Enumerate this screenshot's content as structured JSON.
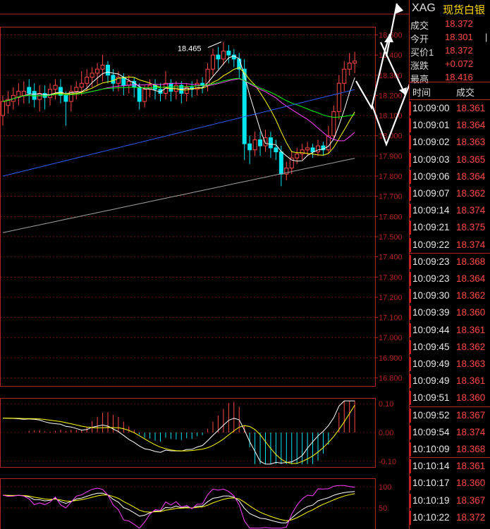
{
  "quote": {
    "symbol": "XAG",
    "name": "现货白银",
    "rows": [
      {
        "label": "成交",
        "value": "18.372",
        "edge": ""
      },
      {
        "label": "今开",
        "value": "18.301",
        "edge": "|"
      },
      {
        "label": "买价1",
        "value": "18.372",
        "edge": ""
      },
      {
        "label": "涨跌",
        "value": "+0.072",
        "edge": ""
      },
      {
        "label": "最高",
        "value": "18.416",
        "edge": ""
      }
    ]
  },
  "ticks": {
    "header_time": "时间",
    "header_price": "成交",
    "rows": [
      {
        "time": "10:09:00",
        "price": "18.361"
      },
      {
        "time": "10:09:01",
        "price": "18.364"
      },
      {
        "time": "10:09:02",
        "price": "18.363"
      },
      {
        "time": "10:09:03",
        "price": "18.365"
      },
      {
        "time": "10:09:06",
        "price": "18.364"
      },
      {
        "time": "10:09:07",
        "price": "18.362"
      },
      {
        "time": "10:09:14",
        "price": "18.374"
      },
      {
        "time": "10:09:21",
        "price": "18.375"
      },
      {
        "time": "10:09:22",
        "price": "18.374"
      },
      {
        "time": "10:09:23",
        "price": "18.368"
      },
      {
        "time": "10:09:23",
        "price": "18.364"
      },
      {
        "time": "10:09:30",
        "price": "18.362"
      },
      {
        "time": "10:09:39",
        "price": "18.360"
      },
      {
        "time": "10:09:44",
        "price": "18.361"
      },
      {
        "time": "10:09:45",
        "price": "18.362"
      },
      {
        "time": "10:09:49",
        "price": "18.363"
      },
      {
        "time": "10:09:49",
        "price": "18.361"
      },
      {
        "time": "10:09:51",
        "price": "18.360"
      },
      {
        "time": "10:09:52",
        "price": "18.367"
      },
      {
        "time": "10:09:54",
        "price": "18.374"
      },
      {
        "time": "10:10:09",
        "price": "18.368"
      },
      {
        "time": "10:10:14",
        "price": "18.361"
      },
      {
        "time": "10:10:17",
        "price": "18.360"
      },
      {
        "time": "10:10:19",
        "price": "18.367"
      },
      {
        "time": "10:10:22",
        "price": "18.372"
      }
    ]
  },
  "colors": {
    "up": "#ff4646",
    "down": "#00e5ee",
    "grid": "#b22222",
    "ma_white": "#ffffff",
    "ma_yellow": "#ffff00",
    "ma_magenta": "#ff40ff",
    "ma_green": "#00ff00",
    "ma_blue": "#3060ff",
    "ma_gray": "#a0a0a0"
  },
  "chart_data": {
    "type": "candlestick",
    "price_axis": {
      "ticks": [
        "18.500",
        "18.400",
        "18.300",
        "18.200",
        "18.100",
        "18.000",
        "17.900",
        "17.800",
        "17.700",
        "17.600",
        "17.500",
        "17.400",
        "17.300",
        "17.200",
        "17.100",
        "17.000",
        "16.900",
        "16.800"
      ],
      "range": [
        16.76,
        18.54
      ]
    },
    "high_marker": "18.465",
    "candles": [
      [
        18.1,
        18.17,
        18.05,
        18.2
      ],
      [
        18.15,
        18.18,
        18.11,
        18.22
      ],
      [
        18.17,
        18.2,
        18.13,
        18.24
      ],
      [
        18.19,
        18.22,
        18.15,
        18.26
      ],
      [
        18.2,
        18.22,
        18.16,
        18.27
      ],
      [
        18.24,
        18.21,
        18.16,
        18.28
      ],
      [
        18.22,
        18.18,
        18.14,
        18.26
      ],
      [
        18.18,
        18.21,
        18.12,
        18.25
      ],
      [
        18.21,
        18.19,
        18.13,
        18.25
      ],
      [
        18.19,
        18.23,
        18.15,
        18.26
      ],
      [
        18.23,
        18.25,
        18.18,
        18.28
      ],
      [
        18.24,
        18.2,
        18.16,
        18.28
      ],
      [
        18.2,
        18.17,
        18.05,
        18.22
      ],
      [
        18.17,
        18.22,
        18.12,
        18.25
      ],
      [
        18.22,
        18.24,
        18.18,
        18.27
      ],
      [
        18.24,
        18.26,
        18.2,
        18.32
      ],
      [
        18.26,
        18.29,
        18.22,
        18.33
      ],
      [
        18.29,
        18.31,
        18.24,
        18.34
      ],
      [
        18.31,
        18.33,
        18.25,
        18.36
      ],
      [
        18.33,
        18.35,
        18.27,
        18.4
      ],
      [
        18.35,
        18.3,
        18.26,
        18.37
      ],
      [
        18.3,
        18.26,
        18.22,
        18.33
      ],
      [
        18.26,
        18.29,
        18.22,
        18.32
      ],
      [
        18.29,
        18.25,
        18.2,
        18.31
      ],
      [
        18.25,
        18.27,
        18.21,
        18.3
      ],
      [
        18.27,
        18.24,
        18.19,
        18.29
      ],
      [
        18.24,
        18.17,
        18.13,
        18.26
      ],
      [
        18.17,
        18.23,
        18.14,
        18.25
      ],
      [
        18.23,
        18.25,
        18.19,
        18.28
      ],
      [
        18.25,
        18.23,
        18.18,
        18.28
      ],
      [
        18.23,
        18.21,
        18.17,
        18.26
      ],
      [
        18.21,
        18.26,
        18.18,
        18.32
      ],
      [
        18.26,
        18.22,
        18.17,
        18.28
      ],
      [
        18.22,
        18.25,
        18.18,
        18.27
      ],
      [
        18.25,
        18.21,
        18.16,
        18.27
      ],
      [
        18.21,
        18.24,
        18.17,
        18.26
      ],
      [
        18.24,
        18.23,
        18.19,
        18.27
      ],
      [
        18.23,
        18.26,
        18.2,
        18.28
      ],
      [
        18.26,
        18.25,
        18.21,
        18.29
      ],
      [
        18.25,
        18.33,
        18.22,
        18.36
      ],
      [
        18.33,
        18.4,
        18.3,
        18.43
      ],
      [
        18.4,
        18.38,
        18.33,
        18.44
      ],
      [
        18.38,
        18.42,
        18.35,
        18.465
      ],
      [
        18.42,
        18.4,
        18.36,
        18.45
      ],
      [
        18.4,
        18.38,
        18.34,
        18.43
      ],
      [
        18.38,
        18.33,
        18.28,
        18.41
      ],
      [
        18.33,
        17.96,
        17.88,
        18.38
      ],
      [
        17.96,
        17.93,
        17.86,
        18.0
      ],
      [
        17.93,
        17.98,
        17.9,
        18.02
      ],
      [
        17.98,
        17.95,
        17.9,
        18.02
      ],
      [
        17.95,
        17.99,
        17.92,
        18.03
      ],
      [
        17.99,
        17.94,
        17.89,
        18.02
      ],
      [
        17.94,
        17.92,
        17.88,
        17.98
      ],
      [
        17.92,
        17.81,
        17.75,
        17.95
      ],
      [
        17.81,
        17.84,
        17.78,
        17.87
      ],
      [
        17.84,
        17.89,
        17.81,
        17.92
      ],
      [
        17.89,
        17.91,
        17.86,
        17.94
      ],
      [
        17.91,
        17.93,
        17.88,
        17.96
      ],
      [
        17.93,
        17.94,
        17.9,
        17.97
      ],
      [
        17.94,
        17.92,
        17.89,
        17.96
      ],
      [
        17.92,
        17.95,
        17.9,
        17.98
      ],
      [
        17.95,
        17.93,
        17.9,
        17.97
      ],
      [
        17.93,
        18.0,
        17.91,
        18.05
      ],
      [
        18.0,
        18.12,
        17.98,
        18.15
      ],
      [
        18.12,
        18.26,
        18.08,
        18.3
      ],
      [
        18.26,
        18.33,
        18.22,
        18.37
      ],
      [
        18.33,
        18.36,
        18.3,
        18.41
      ],
      [
        18.36,
        18.37,
        18.31,
        18.416
      ]
    ],
    "sub1": {
      "ticks": [
        "0.10",
        "0.00",
        "-0.10"
      ],
      "range": [
        -0.12,
        0.12
      ]
    },
    "sub2": {
      "ticks": [
        "100",
        "50"
      ],
      "range": [
        0,
        120
      ]
    }
  }
}
